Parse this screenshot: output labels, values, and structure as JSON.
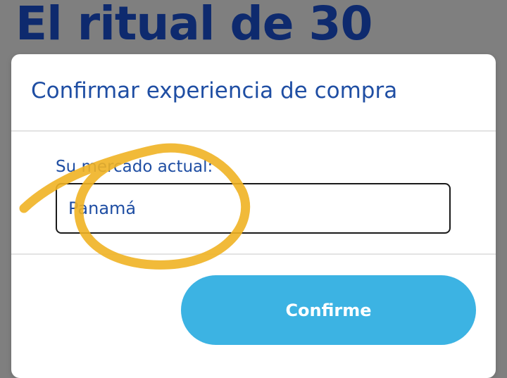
{
  "page": {
    "background_title": "El ritual de 30"
  },
  "modal": {
    "title": "Confirmar experiencia de compra",
    "field": {
      "label": "Su mercado actual:",
      "value": "Panamá"
    },
    "confirm_button_label": "Confirme"
  },
  "colors": {
    "overlay": "#7f7f7f",
    "title_navy": "#0e2a6e",
    "modal_text_blue": "#1f4ea3",
    "button_blue": "#3cb3e3",
    "annotation_yellow": "#f0b323"
  },
  "icons": {
    "annotation": "hand-drawn-circle-marker"
  }
}
